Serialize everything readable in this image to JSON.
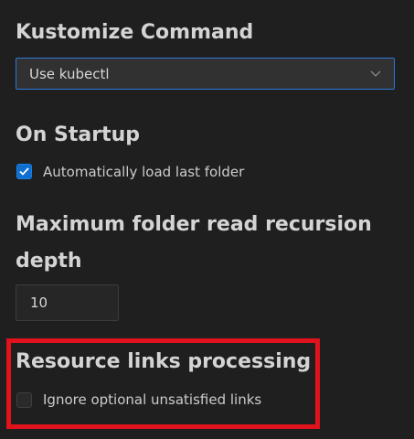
{
  "kustomize": {
    "title": "Kustomize Command",
    "selected_value": "Use kubectl"
  },
  "startup": {
    "title": "On Startup",
    "checkbox_label": "Automatically load last folder",
    "checked": true
  },
  "recursion": {
    "title_line1": "Maximum folder read recursion",
    "title_line2": "depth",
    "value": "10"
  },
  "resource_links": {
    "title": "Resource links processing",
    "checkbox_label": "Ignore optional unsatisfied links",
    "checked": false
  },
  "colors": {
    "background": "#1f1f1f",
    "accent": "#0e6fd0",
    "highlight": "#e0121c"
  },
  "icons": [
    "chevron-down-icon",
    "checkmark-icon"
  ]
}
